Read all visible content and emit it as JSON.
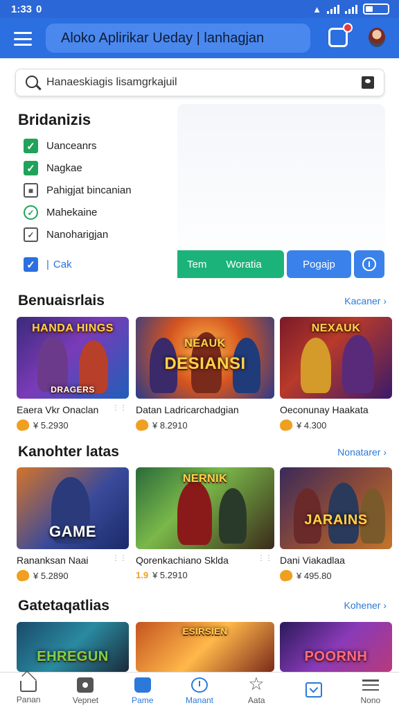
{
  "status": {
    "time": "1:33",
    "indicator": "0"
  },
  "appbar": {
    "title": "Aloko Aplirikar Ueday | lanhagjan"
  },
  "search": {
    "placeholder": "Hanaeskiagis lisamgrkajuil"
  },
  "filters": {
    "title": "Bridanizis",
    "items": [
      {
        "label": "Uanceanrs",
        "state": "checked"
      },
      {
        "label": "Nagkae",
        "state": "checked"
      },
      {
        "label": "Pahigjat bincanian",
        "state": "partial"
      },
      {
        "label": "Mahekaine",
        "state": "circle"
      },
      {
        "label": "Nanoharigjan",
        "state": "empty"
      },
      {
        "label": "Cak",
        "state": "checked-blue"
      }
    ],
    "actions": {
      "green_left": "Tem",
      "green_right": "Woratia",
      "blue": "Pogajp"
    }
  },
  "sections": [
    {
      "title": "Benuaisrlais",
      "more": "Kacaner",
      "cards": [
        {
          "title": "Eaera Vkr Onaclan",
          "price": "¥ 5.2930",
          "overlay": "HANDA HINGS",
          "sub": "DRAGERS"
        },
        {
          "title": "Datan Ladricarchadgian",
          "price": "¥ 8.2910",
          "overlay": "DESIANSI",
          "sub": "NEAUK"
        },
        {
          "title": "Oeconunay Haakata",
          "price": "¥ 4.300",
          "overlay": "NEXAUK",
          "sub": ""
        }
      ]
    },
    {
      "title": "Kanohter latas",
      "more": "Nonatarer",
      "cards": [
        {
          "title": "Rananksan Naai",
          "price": "¥ 5.2890",
          "overlay": "GAME",
          "sub": ""
        },
        {
          "title": "Qorenkachiano Sklda",
          "price": "¥ 5.2910",
          "overlay": "NERNIK",
          "sub": ""
        },
        {
          "title": "Dani Viakadlaa",
          "price": "¥ 495.80",
          "overlay": "JARAINS",
          "sub": ""
        }
      ]
    },
    {
      "title": "Gatetaqatlias",
      "more": "Kohener",
      "cards": [
        {
          "title": "",
          "price": "",
          "overlay": "EHREGUN",
          "sub": ""
        },
        {
          "title": "",
          "price": "",
          "overlay": "ESIRSIEN",
          "sub": ""
        },
        {
          "title": "",
          "price": "",
          "overlay": "POORNH",
          "sub": ""
        }
      ]
    }
  ],
  "bottom_nav": [
    {
      "label": "Panan",
      "icon": "home-icon"
    },
    {
      "label": "Vepnet",
      "icon": "camera-icon"
    },
    {
      "label": "Pame",
      "icon": "game-icon",
      "active": true
    },
    {
      "label": "Manant",
      "icon": "clock-icon",
      "active": true
    },
    {
      "label": "Aata",
      "icon": "star-icon"
    },
    {
      "label": "",
      "icon": "task-icon"
    },
    {
      "label": "Nono",
      "icon": "menu-icon"
    }
  ],
  "colors": {
    "primary": "#2b6fe0",
    "green": "#1bb37a",
    "link": "#2b79d9"
  }
}
